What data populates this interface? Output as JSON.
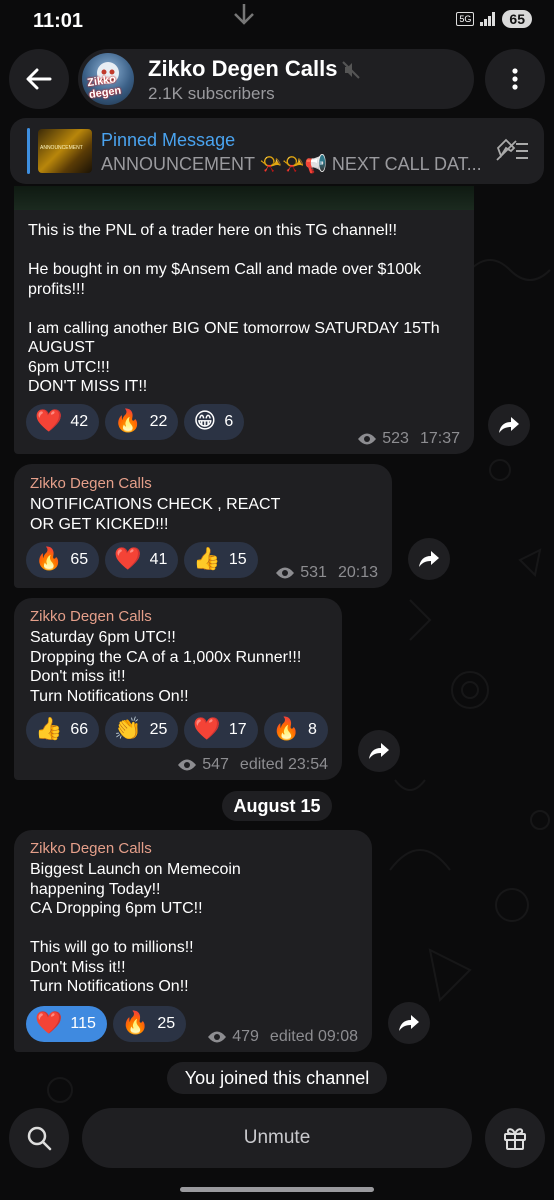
{
  "status_bar": {
    "time": "11:01",
    "network": "5G",
    "battery": "65"
  },
  "header": {
    "channel_name": "Zikko Degen Calls",
    "subscribers": "2.1K subscribers",
    "avatar_text": "Zikko degen"
  },
  "pinned": {
    "title": "Pinned Message",
    "text": "ANNOUNCEMENT 📯📯📢 NEXT CALL DAT...",
    "thumb_text": "ANNOUNCEMENT"
  },
  "messages": [
    {
      "text": "This is the PNL of a trader here on this TG channel!!\n\nHe bought in on my $Ansem Call and made over $100k profits!!!\n\nI am calling another BIG ONE tomorrow SATURDAY 15Th AUGUST\n6pm UTC!!!\nDON'T MISS IT!!",
      "reactions": [
        {
          "emoji": "❤️",
          "count": "42"
        },
        {
          "emoji": "🔥",
          "count": "22"
        },
        {
          "emoji": "😁",
          "count": "6"
        }
      ],
      "views": "523",
      "time": "17:37"
    },
    {
      "sender": "Zikko Degen Calls",
      "text": "NOTIFICATIONS CHECK , REACT\nOR GET KICKED!!!",
      "reactions": [
        {
          "emoji": "🔥",
          "count": "65"
        },
        {
          "emoji": "❤️",
          "count": "41"
        },
        {
          "emoji": "👍",
          "count": "15"
        }
      ],
      "views": "531",
      "time": "20:13"
    },
    {
      "sender": "Zikko Degen Calls",
      "text": "Saturday 6pm UTC!!\nDropping the CA of a 1,000x Runner!!!\nDon't miss it!!\nTurn Notifications On!!",
      "reactions": [
        {
          "emoji": "👍",
          "count": "66"
        },
        {
          "emoji": "👏",
          "count": "25"
        },
        {
          "emoji": "❤️",
          "count": "17"
        },
        {
          "emoji": "🔥",
          "count": "8"
        }
      ],
      "views": "547",
      "time": "edited 23:54"
    },
    {
      "sender": "Zikko Degen Calls",
      "text": "Biggest Launch on Memecoin\nhappening Today!!\nCA Dropping 6pm UTC!!\n\nThis will go to millions!!\nDon't Miss it!!\nTurn Notifications On!!",
      "reactions": [
        {
          "emoji": "❤️",
          "count": "115",
          "active": true
        },
        {
          "emoji": "🔥",
          "count": "25"
        }
      ],
      "views": "479",
      "time": "edited 09:08"
    }
  ],
  "date_separator": "August 15",
  "service_message": "You joined this channel",
  "bottom_bar": {
    "unmute_label": "Unmute"
  },
  "colors": {
    "accent": "#3e8fe0",
    "sender": "#e59f8a",
    "bubble": "#1f1f22",
    "reaction": "#2b3344"
  }
}
